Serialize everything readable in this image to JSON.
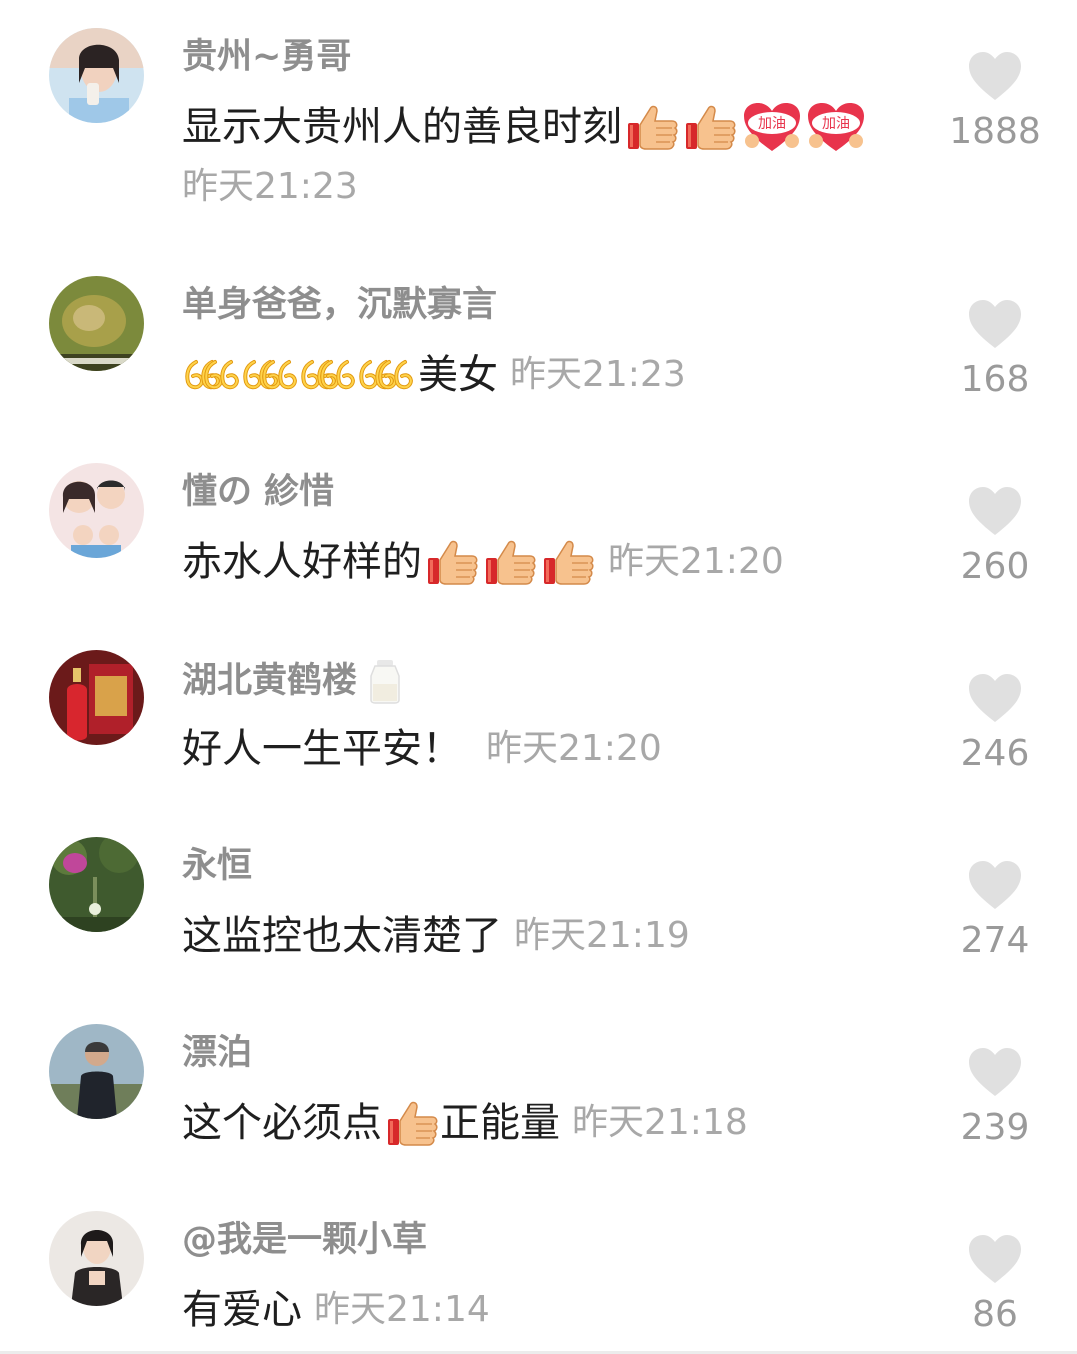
{
  "colors": {
    "username": "#8e8e8e",
    "comment_text": "#1f1f1f",
    "timestamp": "#a8a8a8",
    "like_icon": "#e0e0e0",
    "like_count": "#9a9a9a"
  },
  "comments": [
    {
      "username": "贵州~勇哥",
      "text": "显示大贵州人的善良时刻",
      "emojis": [
        "thumbs-up-icon",
        "thumbs-up-icon",
        "jiayou-heart-icon",
        "jiayou-heart-icon"
      ],
      "emoji_label": "加油",
      "time": "昨天21:23",
      "likes": "1888"
    },
    {
      "username": "单身爸爸，沉默寡言",
      "text_prefix": "666666666666",
      "text": "美女",
      "time": "昨天21:23",
      "likes": "168"
    },
    {
      "username": "懂の 紾惜",
      "text": "赤水人好样的",
      "emojis": [
        "thumbs-up-icon",
        "thumbs-up-icon",
        "thumbs-up-icon"
      ],
      "time": "昨天21:20",
      "likes": "260"
    },
    {
      "username": "湖北黄鹤楼",
      "username_emoji": "milk-bottle-icon",
      "text": "好人一生平安！",
      "time": "昨天21:20",
      "likes": "246"
    },
    {
      "username": "永恒",
      "text": "这监控也太清楚了",
      "time": "昨天21:19",
      "likes": "274"
    },
    {
      "username": "漂泊",
      "text": "这个必须点",
      "emojis": [
        "thumbs-up-icon"
      ],
      "text_suffix": "正能量",
      "time": "昨天21:18",
      "likes": "239"
    },
    {
      "username": "@我是一颗小草",
      "text": "有爱心",
      "time": "昨天21:14",
      "likes": "86"
    }
  ]
}
